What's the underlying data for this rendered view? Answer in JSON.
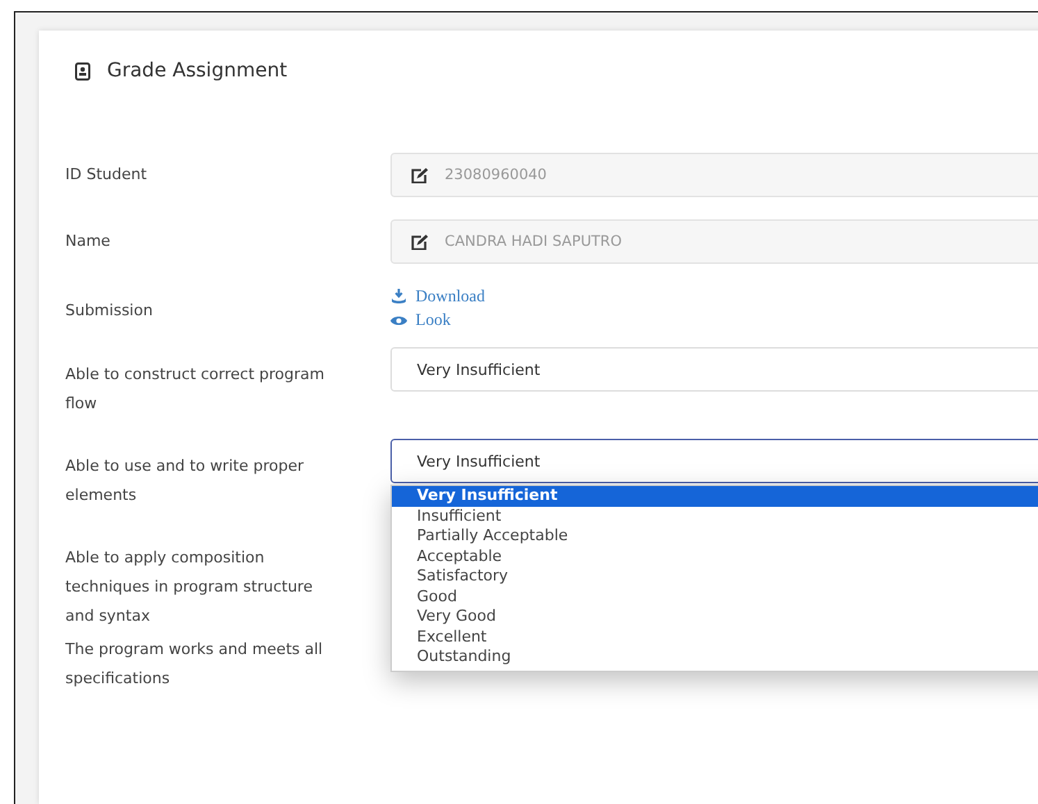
{
  "title": "Grade Assignment",
  "fields": [
    {
      "label": "ID Student",
      "value": "23080960040"
    },
    {
      "label": "Name",
      "value": "CANDRA HADI SAPUTRO"
    }
  ],
  "submission": {
    "label": "Submission",
    "links": [
      {
        "kind": "download",
        "text": "Download"
      },
      {
        "kind": "look",
        "text": "Look"
      }
    ]
  },
  "criteria": [
    {
      "label": "Able to construct correct program flow",
      "value": "Very Insufficient",
      "expanded": false
    },
    {
      "label": "Able to use and to write proper elements",
      "value": "Very Insufficient",
      "expanded": true,
      "options": [
        {
          "text": "Very Insufficient",
          "selected": true
        },
        {
          "text": "Insufficient",
          "selected": false
        },
        {
          "text": "Partially Acceptable",
          "selected": false
        },
        {
          "text": "Acceptable",
          "selected": false
        },
        {
          "text": "Satisfactory",
          "selected": false
        },
        {
          "text": "Good",
          "selected": false
        },
        {
          "text": "Very Good",
          "selected": false
        },
        {
          "text": "Excellent",
          "selected": false
        },
        {
          "text": "Outstanding",
          "selected": false
        }
      ]
    },
    {
      "label": "Able to apply composition techniques in program structure and syntax"
    },
    {
      "label": "The program works and meets all specifications"
    }
  ]
}
